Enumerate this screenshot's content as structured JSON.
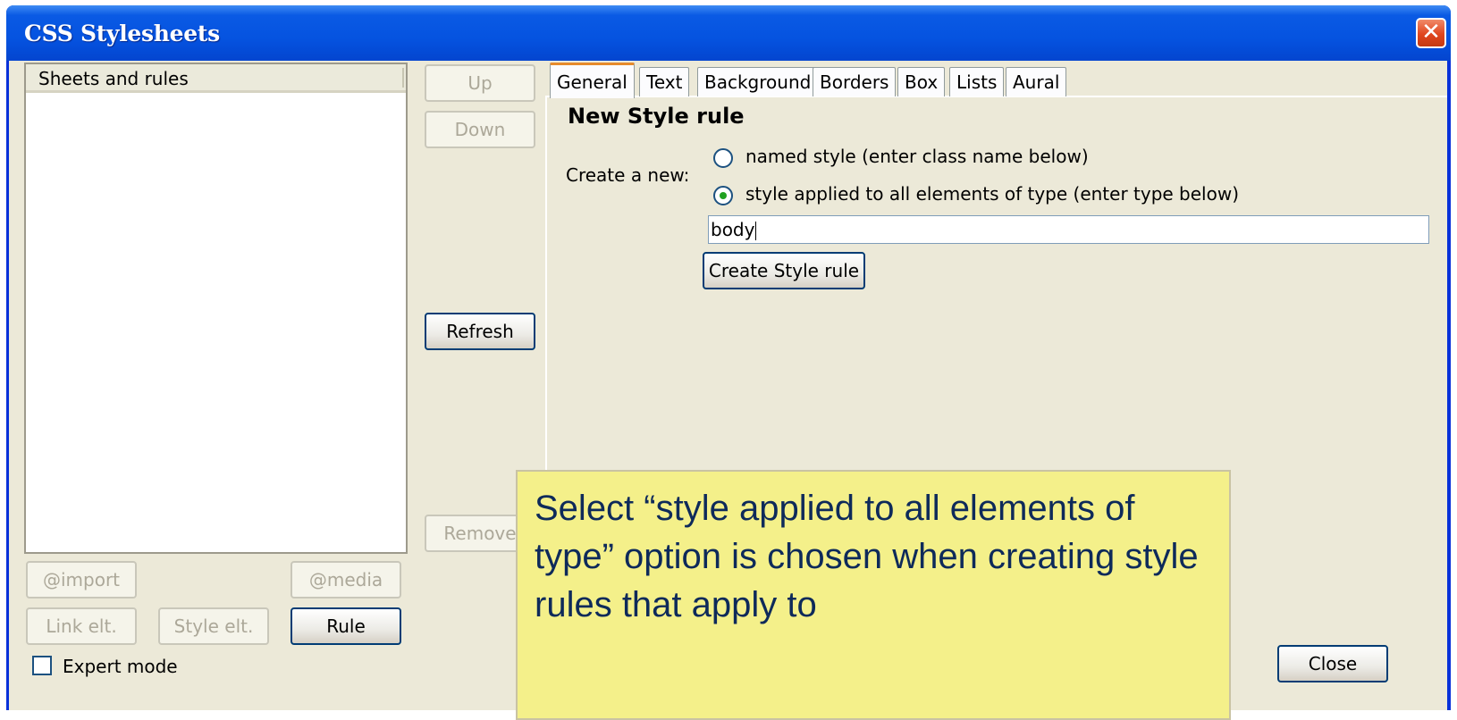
{
  "window": {
    "title": "CSS Stylesheets"
  },
  "tree": {
    "header": "Sheets and rules"
  },
  "order_buttons": {
    "up": "Up",
    "down": "Down",
    "refresh": "Refresh",
    "remove": "Remove"
  },
  "bottom_buttons": {
    "import": "@import",
    "media": "@media",
    "link": "Link elt.",
    "style": "Style elt.",
    "rule": "Rule"
  },
  "expert_mode": {
    "label": "Expert mode",
    "checked": false
  },
  "tabs": [
    "General",
    "Text",
    "Background",
    "Borders",
    "Box",
    "Lists",
    "Aural"
  ],
  "active_tab": "General",
  "general": {
    "heading": "New Style rule",
    "create_label": "Create a new:",
    "option_named": "named style (enter class name below)",
    "option_type": "style applied to all elements of type (enter type below)",
    "selected_option": "type",
    "input_value": "body",
    "create_button": "Create Style rule"
  },
  "close_button": "Close",
  "callout": {
    "text": "Select “style applied to all elements of type” option is chosen when creating style rules that apply to"
  },
  "colors": {
    "titlebar": "#0553e0",
    "dialog_bg": "#ece9d8",
    "callout_bg": "#f4f08a",
    "callout_text": "#0e2a5a"
  }
}
